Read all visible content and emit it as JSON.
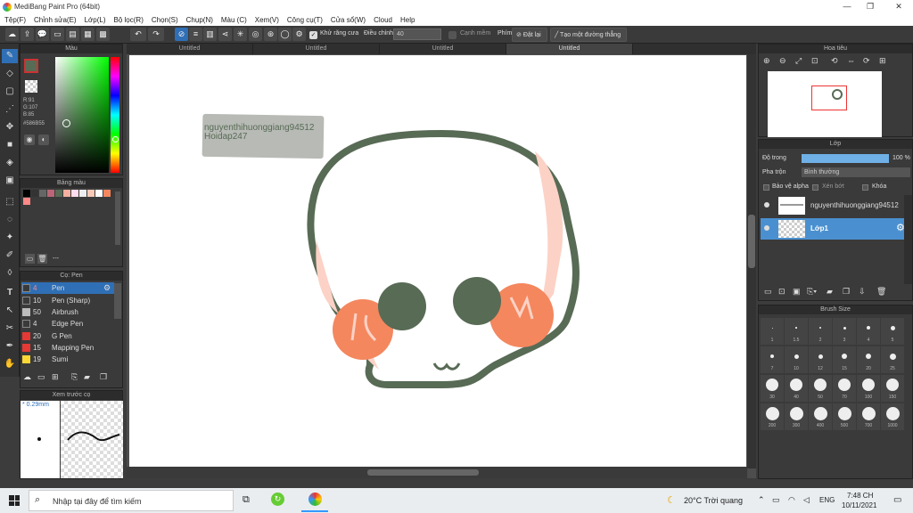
{
  "window": {
    "title": "MediBang Paint Pro (64bit)",
    "minimize": "—",
    "maximize": "❐",
    "close": "✕"
  },
  "menu": [
    "Tệp(F)",
    "Chỉnh sửa(E)",
    "Lớp(L)",
    "Bộ lọc(R)",
    "Chọn(S)",
    "Chụp(N)",
    "Màu (C)",
    "Xem(V)",
    "Công cụ(T)",
    "Cửa sổ(W)",
    "Cloud",
    "Help"
  ],
  "toolbar": {
    "antialias_label": "Khử răng cưa",
    "adjust_label": "Điều chỉnh",
    "adjust_value": "40",
    "edge_label": "Cạnh mềm",
    "key_label": "Phím",
    "reset_label": "Đặt lại",
    "straight_line_label": "Tạo một đường thẳng"
  },
  "tabs": [
    "Untitled",
    "Untitled",
    "Untitled",
    "Untitled"
  ],
  "color_panel": {
    "title": "Màu",
    "r": "R:91",
    "g": "G:107",
    "b": "B:85",
    "hex": "#586B55"
  },
  "palette_panel": {
    "title": "Bảng màu",
    "bottom_label": "---"
  },
  "brush_panel": {
    "title": "Cọ: Pen",
    "items": [
      {
        "num": "4",
        "name": "Pen",
        "color": "#3a3a3a"
      },
      {
        "num": "10",
        "name": "Pen (Sharp)",
        "color": "#3a3a3a"
      },
      {
        "num": "50",
        "name": "Airbrush",
        "color": "#bbbbbb"
      },
      {
        "num": "4",
        "name": "Edge Pen",
        "color": "#3a3a3a"
      },
      {
        "num": "20",
        "name": "G Pen",
        "color": "#e53935"
      },
      {
        "num": "15",
        "name": "Mapping Pen",
        "color": "#e53935"
      },
      {
        "num": "19",
        "name": "Sumi",
        "color": "#fdd835"
      }
    ]
  },
  "preview_panel": {
    "title": "Xem trước cọ",
    "size": "* 0.29mm"
  },
  "canvas": {
    "text_line1": "nguyenthihuonggiang94512",
    "text_line2": "Hoidap247"
  },
  "navigator": {
    "title": "Hoa tiêu"
  },
  "layer_panel": {
    "title": "Lớp",
    "opacity_label": "Độ trong",
    "opacity_value": "100 %",
    "blend_label": "Pha trộn",
    "blend_value": "Bình thường",
    "protect_alpha": "Bảo vệ alpha",
    "clipping": "Xén bớt",
    "lock": "Khóa",
    "layers": [
      {
        "name": "nguyenthihuonggiang94512"
      },
      {
        "name": "Lớp1"
      }
    ]
  },
  "brush_size": {
    "title": "Brush Size",
    "sizes": [
      "1",
      "1.5",
      "2",
      "3",
      "4",
      "5",
      "7",
      "10",
      "12",
      "15",
      "20",
      "25",
      "30",
      "40",
      "50",
      "70",
      "100",
      "150",
      "200",
      "300",
      "400",
      "500",
      "700",
      "1000"
    ]
  },
  "taskbar": {
    "search_placeholder": "Nhập tại đây để tìm kiếm",
    "weather": "20°C  Trời quang",
    "lang": "ENG",
    "time": "7:48 CH",
    "date": "10/11/2021"
  },
  "colors": {
    "accent": "#2f6fb5",
    "outline": "#586B55",
    "cheek": "#f4875e",
    "blush": "#fcd2c6"
  }
}
